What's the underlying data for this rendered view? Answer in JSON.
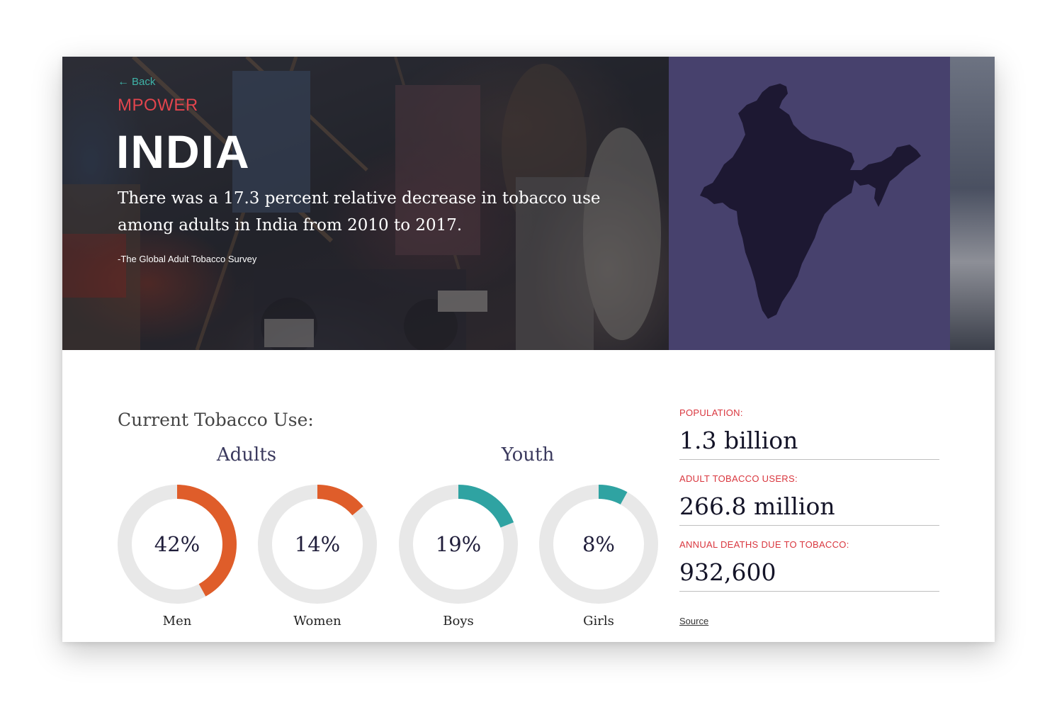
{
  "hero": {
    "back_label": "Back",
    "brand": "MPOWER",
    "country": "INDIA",
    "quote": "There was a 17.3 percent relative decrease in tobacco use among adults in India from 2010 to 2017.",
    "attribution": "-The Global Adult Tobacco Survey",
    "map_panel_color": "#47416d",
    "map_fill_color": "#1d1832"
  },
  "content": {
    "section_title": "Current Tobacco Use:",
    "groups": [
      {
        "title": "Adults"
      },
      {
        "title": "Youth"
      }
    ],
    "donuts": [
      {
        "label": "Men",
        "display": "42%",
        "percent": 42,
        "color": "#df5d2a"
      },
      {
        "label": "Women",
        "display": "14%",
        "percent": 14,
        "color": "#df5d2a"
      },
      {
        "label": "Boys",
        "display": "19%",
        "percent": 19,
        "color": "#2fa3a2"
      },
      {
        "label": "Girls",
        "display": "8%",
        "percent": 8,
        "color": "#2fa3a2"
      }
    ],
    "track_color": "#e8e8e8"
  },
  "stats": {
    "population_label": "POPULATION:",
    "population_value": "1.3 billion",
    "users_label": "ADULT TOBACCO USERS:",
    "users_value": "266.8 million",
    "deaths_label": "ANNUAL DEATHS DUE TO TOBACCO:",
    "deaths_value": "932,600",
    "source_label": "Source"
  }
}
